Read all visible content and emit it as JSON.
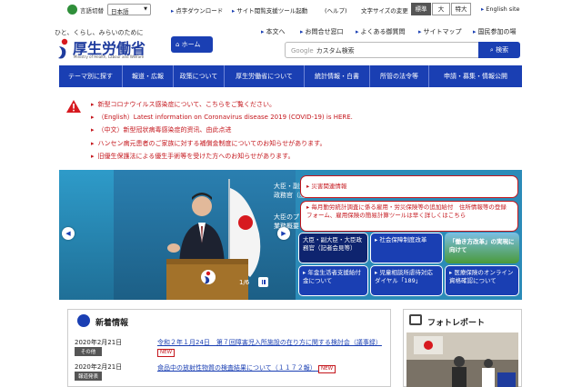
{
  "utility": {
    "lang_label": "言語切替",
    "lang_value": "日本語",
    "links": [
      "点字ダウンロード",
      "サイト閲覧支援ツール起動",
      "(ヘルプ)"
    ],
    "font_size_label": "文字サイズの変更",
    "font_sizes": [
      "標準",
      "大",
      "特大"
    ],
    "english": "English site"
  },
  "header": {
    "tagline": "ひと、くらし、みらいのために",
    "logo": "厚生労働省",
    "logo_sub": "Ministry of Health, Labour and Welfare",
    "home": "ホーム",
    "links": [
      "本文へ",
      "お問合せ窓口",
      "よくある御質問",
      "サイトマップ",
      "国民参加の場"
    ],
    "search_prefix": "Google",
    "search_placeholder": "カスタム検索",
    "search_button": "検索"
  },
  "nav": [
    "テーマ別に探す",
    "報道・広報",
    "政策について",
    "厚生労働省について",
    "統計情報・白書",
    "所管の法令等",
    "申請・募集・情報公開"
  ],
  "alerts": [
    "新型コロナウイルス感染症について、こちらをご覧ください。",
    "（English）Latest information on Coronavirus disease 2019 (COVID-19) is HERE.",
    "（中文）新型冠状病毒感染症的资讯、由此点进",
    "ハンセン病元患者のご家族に対する補償金制度についてのお知らせがあります。",
    "旧優生保護法による優生手術等を受けた方へのお知らせがあります。"
  ],
  "carousel": {
    "caption_main": "大臣・副大臣・大臣政務官（記者会見等）",
    "caption_sub": "大臣のプロフィールや業務概要",
    "pager": "1/6",
    "tiles": {
      "disaster": "災害関連情報",
      "monthly": "毎月勤労統計調査に係る雇用・労災保険等の追加給付　住所情報等の登録フォーム、雇用保険の簡易計算ツールは早く詳しくはこちら",
      "minister": "大臣・副大臣・大臣政務官（記者会見等）",
      "social": "社会保障制度改革",
      "work_style": "「働き方改革」の実現に向けて",
      "pension": "年金生活者支援給付金について",
      "child": "児童相談所虐待対応ダイヤル「189」",
      "insurance": "医療保険のオンライン資格確認について"
    }
  },
  "news": {
    "title": "新着情報",
    "items": [
      {
        "date": "2020年2月21日",
        "tag": "その他",
        "text": "令和２年１月24日　第７回障害児入所施設の在り方に関する検討会（議事録）",
        "badge": "NEW"
      },
      {
        "date": "2020年2月21日",
        "tag": "報道発表",
        "text": "食品中の放射性物質の検査結果について（１１７２報）",
        "badge": "NEW"
      }
    ]
  },
  "photo_report": {
    "title": "フォトレポート"
  }
}
